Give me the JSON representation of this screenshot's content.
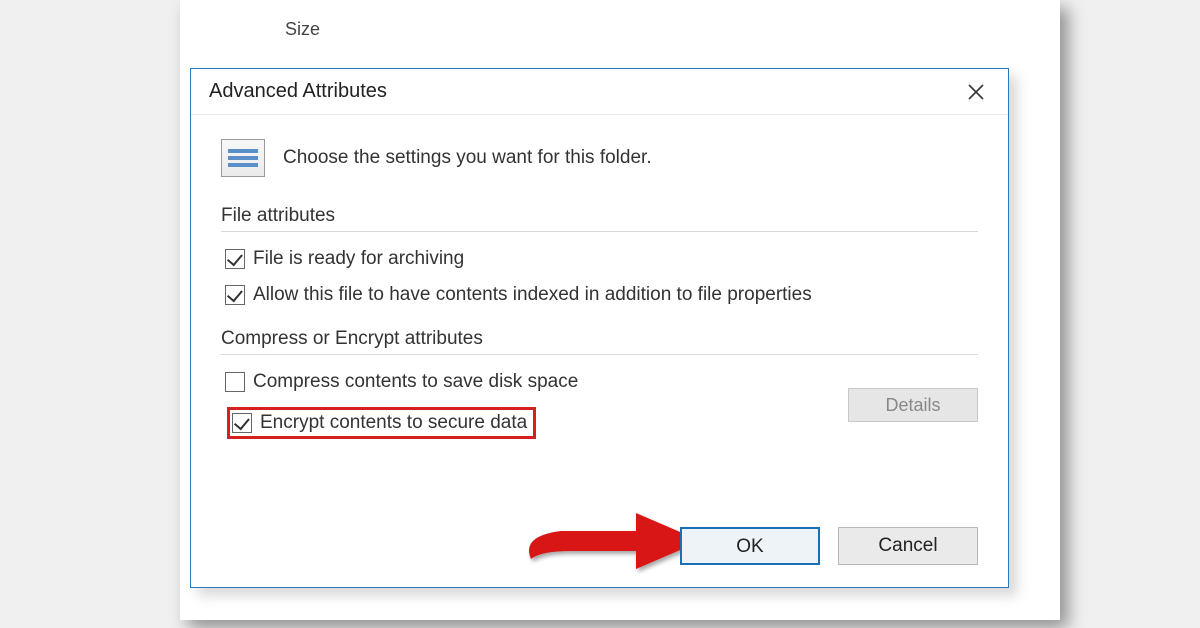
{
  "background": {
    "column_header": "Size"
  },
  "dialog": {
    "title": "Advanced Attributes",
    "intro_text": "Choose the settings you want for this folder.",
    "groups": {
      "file_attributes": {
        "label": "File attributes",
        "checkboxes": {
          "archive": {
            "label": "File is ready for archiving",
            "checked": true
          },
          "index": {
            "label": "Allow this file to have contents indexed in addition to file properties",
            "checked": true
          }
        }
      },
      "compress_encrypt": {
        "label": "Compress or Encrypt attributes",
        "checkboxes": {
          "compress": {
            "label": "Compress contents to save disk space",
            "checked": false
          },
          "encrypt": {
            "label": "Encrypt contents to secure data",
            "checked": true
          }
        },
        "details_button": "Details"
      }
    },
    "buttons": {
      "ok": "OK",
      "cancel": "Cancel"
    }
  }
}
